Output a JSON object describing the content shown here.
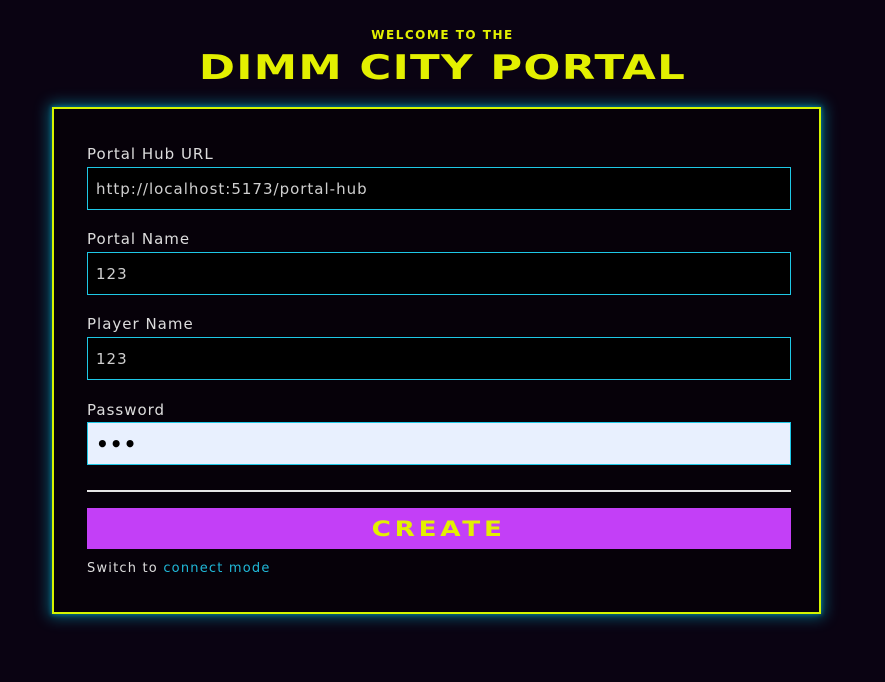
{
  "header": {
    "subtitle": "WELCOME TO THE",
    "title": "DIMM CITY PORTAL"
  },
  "form": {
    "fields": [
      {
        "label": "Portal Hub URL",
        "value": "http://localhost:5173/portal-hub",
        "type": "text"
      },
      {
        "label": "Portal Name",
        "value": "123",
        "type": "text"
      },
      {
        "label": "Player Name",
        "value": "123",
        "type": "text"
      },
      {
        "label": "Password",
        "value": "123",
        "type": "password"
      }
    ],
    "submit_label": "CREATE",
    "switch_prefix": "Switch to",
    "switch_link": "connect mode"
  },
  "colors": {
    "background": "#0a0312",
    "accent_yellow": "#e3f000",
    "border_cyan": "#1ec8e6",
    "button_purple": "#c33ff7",
    "link_cyan": "#20b8d8"
  }
}
